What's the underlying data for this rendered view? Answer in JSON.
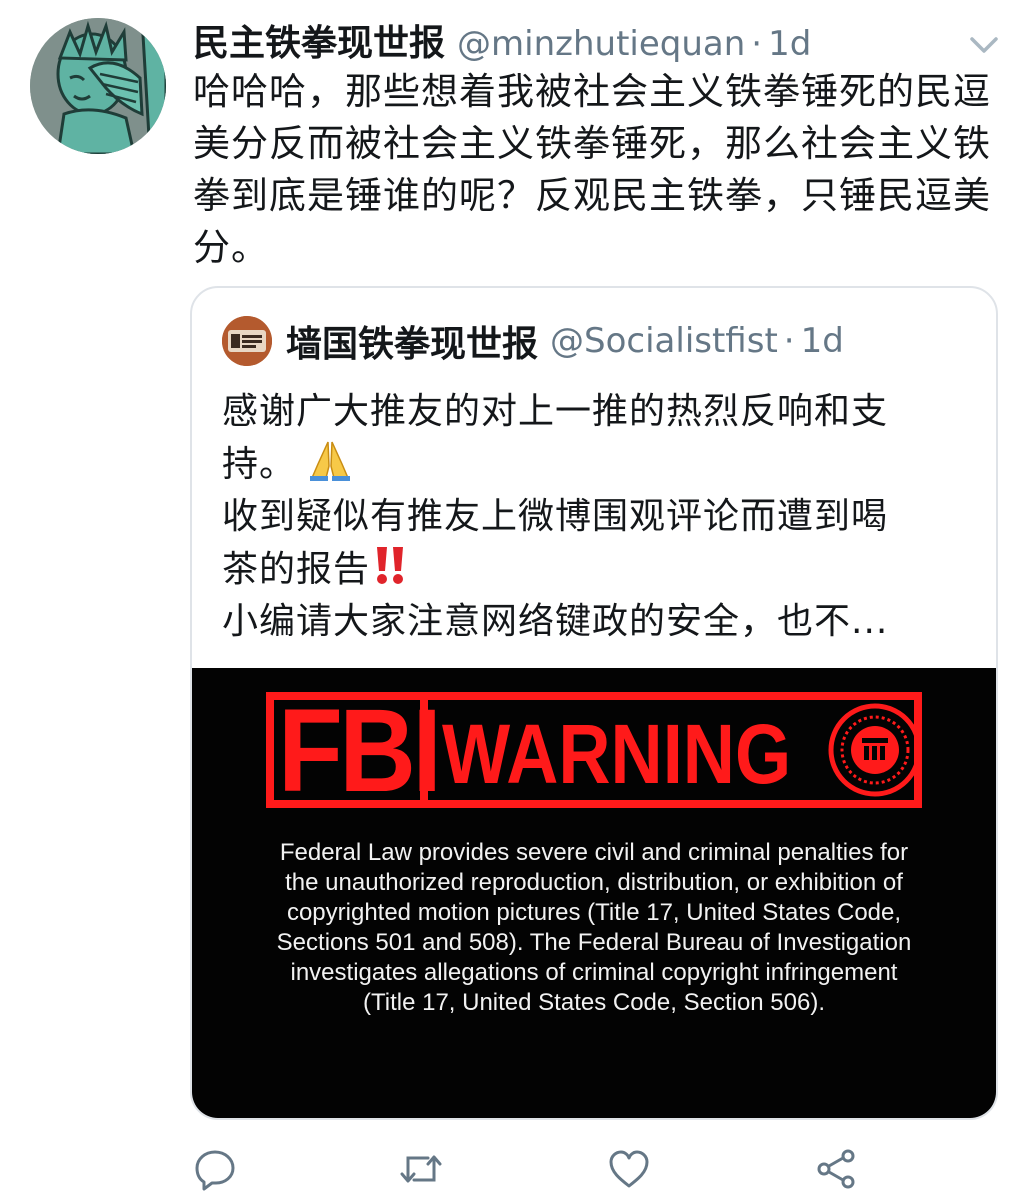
{
  "tweet": {
    "display_name": "民主铁拳现世报",
    "handle": "@minzhutiequan",
    "separator": "·",
    "time": "1d",
    "text": "哈哈哈，那些想着我被社会主义铁拳锤死的民逗美分反而被社会主义铁拳锤死，那么社会主义铁拳到底是锤谁的呢？反观民主铁拳，只锤民逗美分。"
  },
  "quote": {
    "display_name": "墙国铁拳现世报",
    "handle": "@Socialistfist",
    "separator": "·",
    "time": "1d",
    "lines": {
      "l1": "感谢广大推友的对上一推的热烈反响和支",
      "l2": "持。",
      "l3": "收到疑似有推友上微博围观评论而遭到喝",
      "l4": "茶的报告",
      "l5": "小编请大家注意网络键政的安全，也不..."
    },
    "emoji_1": "folded-hands",
    "emoji_2": "double-exclamation",
    "media": {
      "brand_text": "FBI",
      "warning_text": "WARNING",
      "seal_icon": "fbi-seal-icon",
      "legal_lines": {
        "l1": "Federal Law provides severe civil and criminal penalties for",
        "l2": "the unauthorized reproduction, distribution, or exhibition of",
        "l3": "copyrighted motion pictures (Title 17, United States Code,",
        "l4": "Sections 501 and 508).  The Federal Bureau of Investigation",
        "l5": "investigates allegations of criminal copyright infringement",
        "l6": "(Title 17, United States Code, Section 506)."
      },
      "background_color": "#030303",
      "accent_color": "#ff1a1a"
    }
  },
  "actions": {
    "reply_icon": "reply-icon",
    "retweet_icon": "retweet-icon",
    "like_icon": "like-icon",
    "share_icon": "share-icon"
  },
  "colors": {
    "text_primary": "#14171a",
    "text_secondary": "#657786",
    "border": "#dfe3e8",
    "icon": "#657786"
  }
}
